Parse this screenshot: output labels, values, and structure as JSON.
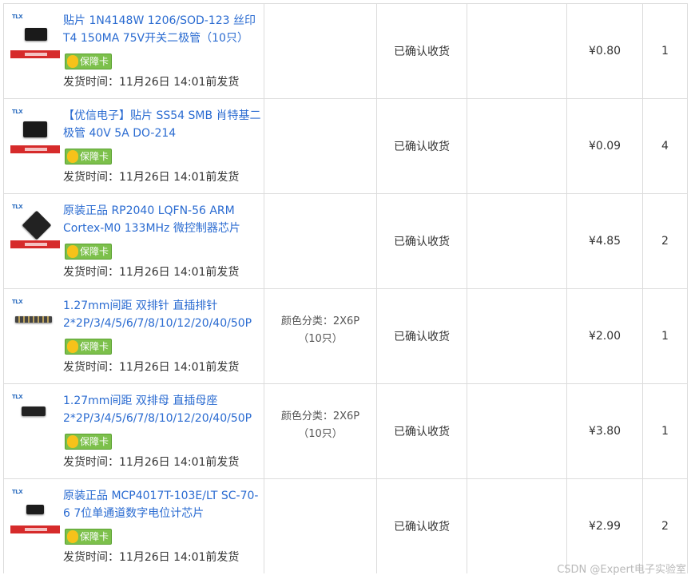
{
  "orders": [
    {
      "title": "贴片 1N4148W 1206/SOD-123 丝印T4 150MA 75V开关二极管（10只）",
      "thumb_icon": "sod123-diode-icon",
      "badge": "保障卡",
      "ship_label": "发货时间：",
      "ship_time": "11月26日 14:01前发货",
      "spec": "",
      "spec_note": "",
      "status": "已确认收货",
      "price": "¥0.80",
      "qty": "1"
    },
    {
      "title": "【优信电子】贴片 SS54 SMB 肖特基二极管 40V 5A DO-214",
      "thumb_icon": "smb-diode-icon",
      "badge": "保障卡",
      "ship_label": "发货时间：",
      "ship_time": "11月26日 14:01前发货",
      "spec": "",
      "spec_note": "",
      "status": "已确认收货",
      "price": "¥0.09",
      "qty": "4"
    },
    {
      "title": "原装正品 RP2040 LQFN-56 ARM Cortex-M0 133MHz 微控制器芯片",
      "thumb_icon": "qfn-chip-icon",
      "badge": "保障卡",
      "ship_label": "发货时间：",
      "ship_time": "11月26日 14:01前发货",
      "spec": "",
      "spec_note": "",
      "status": "已确认收货",
      "price": "¥4.85",
      "qty": "2"
    },
    {
      "title": "1.27mm间距 双排针 直插排针2*2P/3/4/5/6/7/8/10/12/20/40/50P",
      "thumb_icon": "pin-header-icon",
      "badge": "保障卡",
      "ship_label": "发货时间：",
      "ship_time": "11月26日 14:01前发货",
      "spec": "颜色分类：2X6P",
      "spec_note": "（10只）",
      "status": "已确认收货",
      "price": "¥2.00",
      "qty": "1"
    },
    {
      "title": "1.27mm间距 双排母 直插母座2*2P/3/4/5/6/7/8/10/12/20/40/50P",
      "thumb_icon": "female-header-icon",
      "badge": "保障卡",
      "ship_label": "发货时间：",
      "ship_time": "11月26日 14:01前发货",
      "spec": "颜色分类：2X6P",
      "spec_note": "（10只）",
      "status": "已确认收货",
      "price": "¥3.80",
      "qty": "1"
    },
    {
      "title": "原装正品 MCP4017T-103E/LT SC-70-6 7位单通道数字电位计芯片",
      "thumb_icon": "sc70-chip-icon",
      "badge": "保障卡",
      "ship_label": "发货时间：",
      "ship_time": "11月26日 14:01前发货",
      "spec": "",
      "spec_note": "",
      "status": "已确认收货",
      "price": "¥2.99",
      "qty": "2"
    }
  ],
  "watermark": "CSDN @Expert电子实验室"
}
